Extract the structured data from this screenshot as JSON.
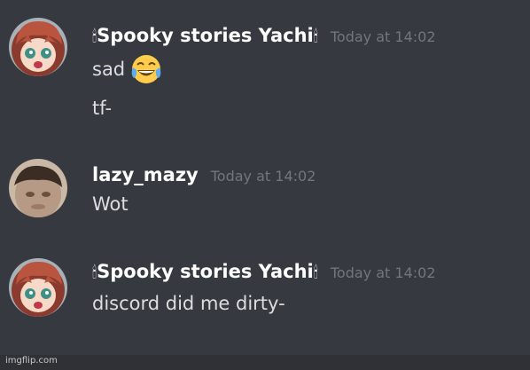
{
  "messages": [
    {
      "username": "Spooky stories Yachi",
      "prefix_glyph": "🕯",
      "suffix_glyph": "🕯",
      "timestamp": "Today at 14:02",
      "lines": [
        "sad",
        "tf-"
      ],
      "emoji": "joy-emoji",
      "avatar": "red-haired-anime-girl-avatar"
    },
    {
      "username": "lazy_mazy",
      "timestamp": "Today at 14:02",
      "lines": [
        "Wot"
      ],
      "avatar": "blurry-photo-avatar"
    },
    {
      "username": "Spooky stories Yachi",
      "prefix_glyph": "🕯",
      "suffix_glyph": "🕯",
      "timestamp": "Today at 14:02",
      "lines": [
        "discord did me dirty-"
      ],
      "avatar": "red-haired-anime-girl-avatar"
    }
  ],
  "watermark": "imgflip.com",
  "colors": {
    "background": "#36393f",
    "username": "#ffffff",
    "message_text": "#dcddde",
    "timestamp": "#72767d"
  }
}
